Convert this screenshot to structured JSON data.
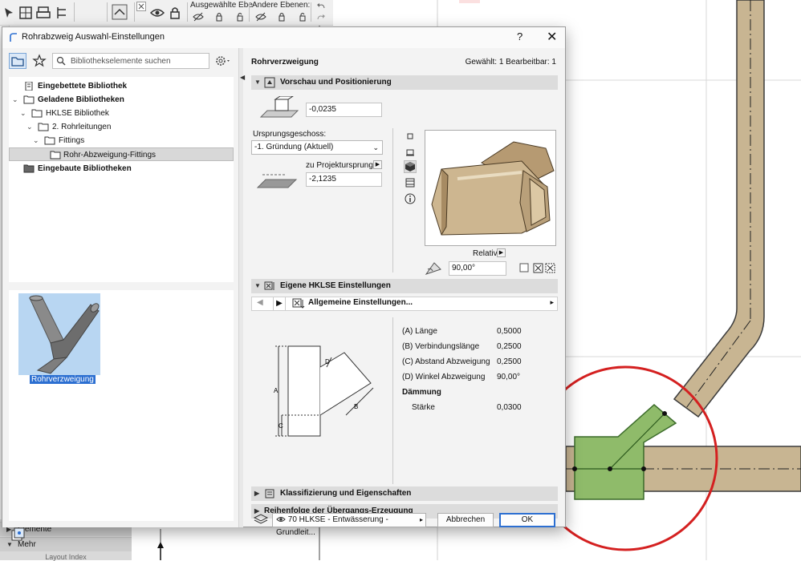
{
  "toolbar": {
    "label_selected": "Ausgewählte Ebe",
    "label_other": "Andere Ebenen:"
  },
  "navpanel": {
    "row1": "Elemente",
    "row2": "Mehr",
    "footer": "Layout Index"
  },
  "dialog": {
    "title": "Rohrabzweig Auswahl-Einstellungen",
    "help": "?",
    "close": "✕"
  },
  "library": {
    "search_placeholder": "Bibliothekselemente suchen",
    "tree": [
      {
        "label": "Eingebettete Bibliothek"
      },
      {
        "label": "Geladene Bibliotheken"
      },
      {
        "label": "HKLSE Bibliothek"
      },
      {
        "label": "2. Rohrleitungen"
      },
      {
        "label": "Fittings"
      },
      {
        "label": "Rohr-Abzweigung-Fittings"
      },
      {
        "label": "Eingebaute Bibliotheken"
      }
    ],
    "selected_object": "Rohrverzweigung"
  },
  "settings": {
    "object_name": "Rohrverzweigung",
    "selection_status": "Gewählt: 1 Bearbeitbar: 1",
    "sections": {
      "preview": "Vorschau und Positionierung",
      "own": "Eigene HKLSE Einstellungen",
      "classification": "Klassifizierung und Eigenschaften",
      "order": "Reihenfolge der Übergangs-Erzeugung"
    },
    "positioning": {
      "elevation_value": "-0,0235",
      "origin_story_label": "Ursprungsgeschoss:",
      "origin_story_value": "-1. Gründung (Aktuell)",
      "project_zero_label": "zu Projektursprung",
      "project_zero_value": "-2,1235",
      "relative_label": "Relativ",
      "angle_value": "90,00°"
    },
    "page_selector": "Allgemeine Einstellungen...",
    "diagram_labels": {
      "a": "A",
      "b": "B",
      "c": "C",
      "d": "D"
    },
    "parameters": [
      {
        "label": "(A) Länge",
        "value": "0,5000"
      },
      {
        "label": "(B) Verbindungslänge",
        "value": "0,2500"
      },
      {
        "label": "(C) Abstand Abzweigung",
        "value": "0,2500"
      },
      {
        "label": "(D) Winkel Abzweigung",
        "value": "90,00°"
      },
      {
        "label": "Dämmung",
        "value": ""
      },
      {
        "label": "Stärke",
        "value": "0,0300"
      }
    ]
  },
  "footer": {
    "layer_value": "70 HLKSE - Entwässerung - Grundleit...",
    "cancel": "Abbrechen",
    "ok": "OK"
  },
  "colors": {
    "pipe_fill": "#c8b592",
    "fitting_fill": "#8fbb6a",
    "highlight_circle": "#d42020",
    "accent_blue": "#2c6fd1"
  }
}
